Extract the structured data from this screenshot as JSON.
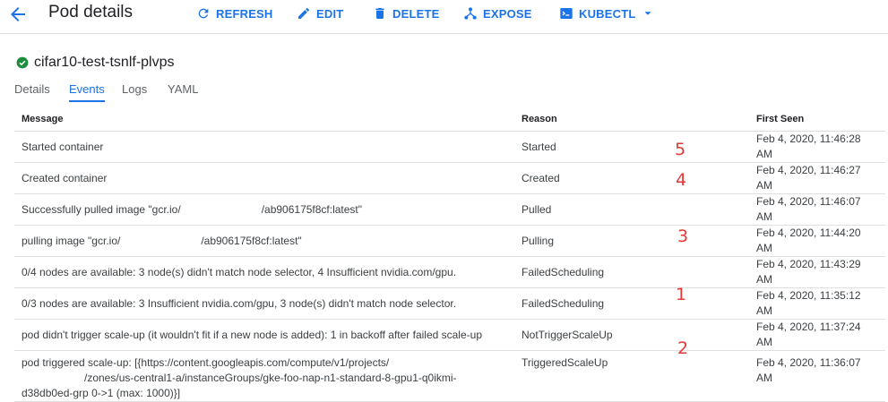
{
  "header": {
    "title": "Pod details",
    "actions": {
      "refresh": "REFRESH",
      "edit": "EDIT",
      "delete": "DELETE",
      "expose": "EXPOSE",
      "kubectl": "KUBECTL"
    }
  },
  "pod": {
    "name": "cifar10-test-tsnlf-plvps",
    "status": "ok"
  },
  "tabs": [
    "Details",
    "Events",
    "Logs",
    "YAML"
  ],
  "active_tab": "Events",
  "table": {
    "columns": [
      "Message",
      "Reason",
      "First Seen"
    ],
    "rows": [
      {
        "message_pre": "Started container",
        "message_post": "",
        "reason": "Started",
        "first_seen": "Feb 4, 2020, 11:46:28 AM"
      },
      {
        "message_pre": "Created container",
        "message_post": "",
        "reason": "Created",
        "first_seen": "Feb 4, 2020, 11:46:27 AM"
      },
      {
        "message_pre": "Successfully pulled image \"gcr.io/",
        "message_post": "/ab906175f8cf:latest\"",
        "reason": "Pulled",
        "first_seen": "Feb 4, 2020, 11:46:07 AM"
      },
      {
        "message_pre": "pulling image \"gcr.io/",
        "message_post": "/ab906175f8cf:latest\"",
        "reason": "Pulling",
        "first_seen": "Feb 4, 2020, 11:44:20 AM"
      },
      {
        "message_pre": "0/4 nodes are available: 3 node(s) didn't match node selector, 4 Insufficient nvidia.com/gpu.",
        "message_post": "",
        "reason": "FailedScheduling",
        "first_seen": "Feb 4, 2020, 11:43:29 AM"
      },
      {
        "message_pre": "0/3 nodes are available: 3 Insufficient nvidia.com/gpu, 3 node(s) didn't match node selector.",
        "message_post": "",
        "reason": "FailedScheduling",
        "first_seen": "Feb 4, 2020, 11:35:12 AM"
      },
      {
        "message_pre": "pod didn't trigger scale-up (it wouldn't fit if a new node is added): 1 in backoff after failed scale-up",
        "message_post": "",
        "reason": "NotTriggerScaleUp",
        "first_seen": "Feb 4, 2020, 11:37:24 AM"
      },
      {
        "message_pre": "pod triggered scale-up: [{https://content.googleapis.com/compute/v1/projects/",
        "message_post": "/zones/us-central1-a/instanceGroups/gke-foo-nap-n1-standard-8-gpu1-q0ikmi-d38db0ed-grp 0->1 (max: 1000)}]",
        "reason": "TriggeredScaleUp",
        "first_seen": "Feb 4, 2020, 11:36:07 AM"
      }
    ]
  },
  "annotations": [
    "5",
    "4",
    "3",
    "1",
    "2"
  ],
  "colors": {
    "accent": "#1a73e8",
    "success": "#1e8e3e",
    "annotation": "#e53935"
  }
}
